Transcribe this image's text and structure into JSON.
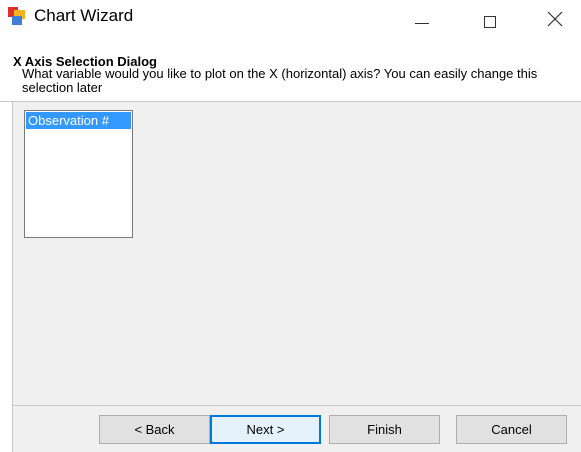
{
  "window": {
    "title": "Chart Wizard",
    "icon": "chart-wizard-app-icon",
    "controls": {
      "minimize_icon": "minimize-icon",
      "maximize_icon": "maximize-icon",
      "close_icon": "close-icon"
    }
  },
  "header": {
    "heading": "X Axis Selection Dialog",
    "description": "What variable would you like to plot on the X (horizontal) axis? You can easily change this selection later"
  },
  "variables": {
    "items": [
      {
        "label": "Observation #",
        "selected": true
      }
    ]
  },
  "buttons": {
    "back": "< Back",
    "next": "Next >",
    "finish": "Finish",
    "cancel": "Cancel"
  },
  "colors": {
    "selection": "#3399ff",
    "default_button_border": "#0078d7",
    "dialog_background": "#f0f0f0"
  }
}
